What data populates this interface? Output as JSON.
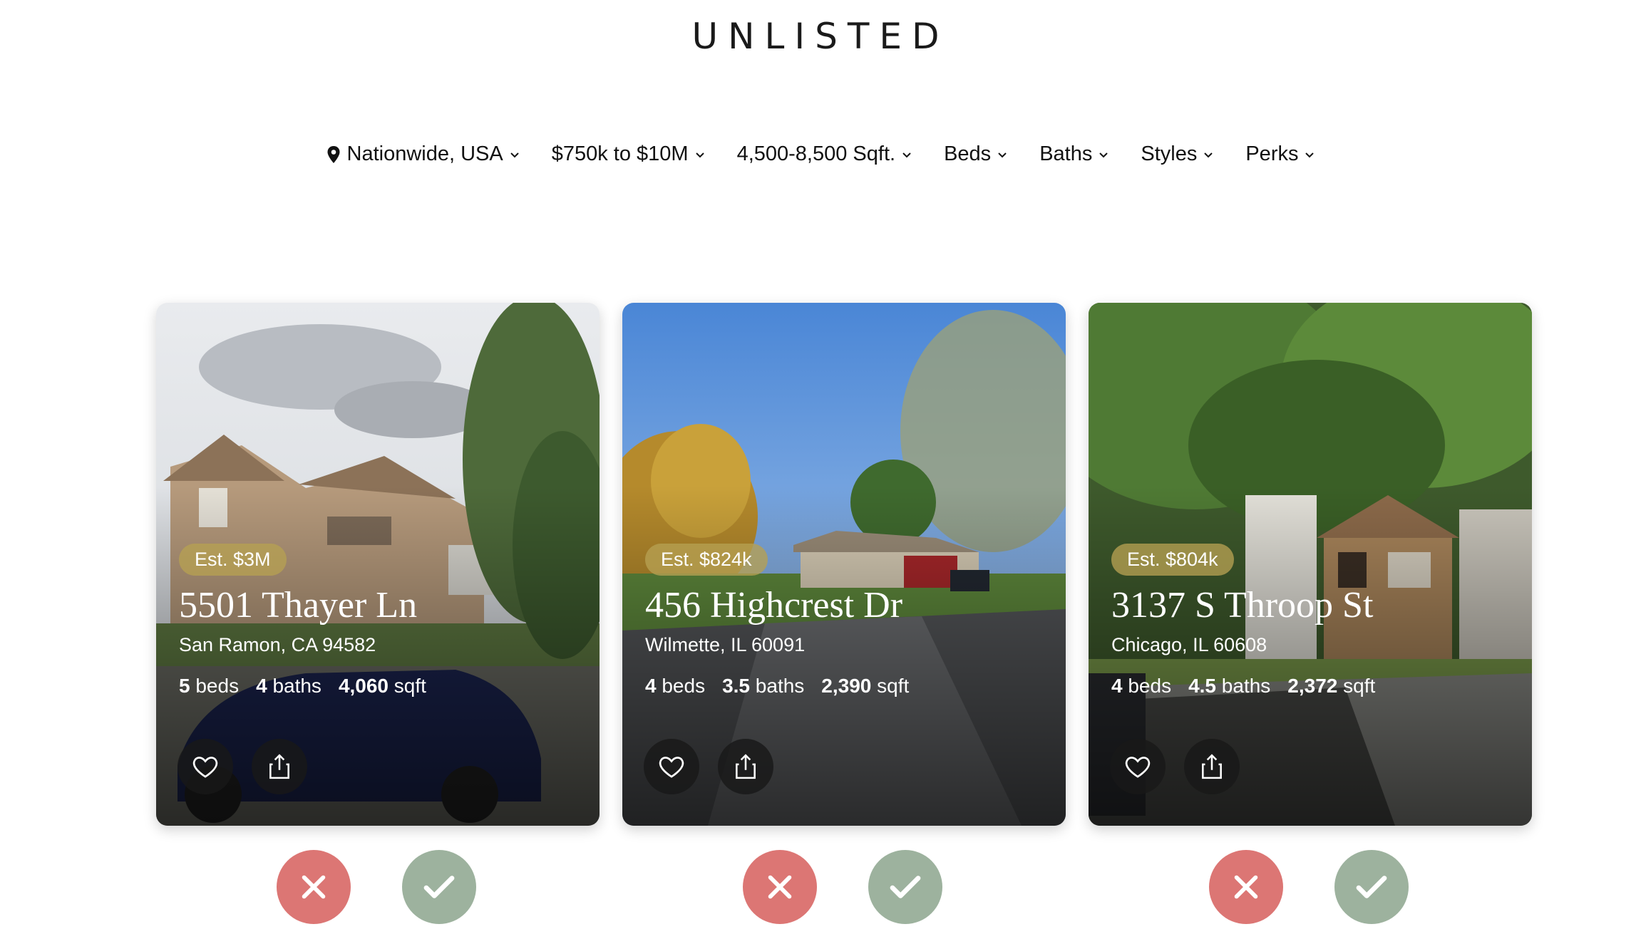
{
  "brand": {
    "logo": "UNLISTED"
  },
  "filters": [
    {
      "label": "Nationwide, USA",
      "icon": "location-pin-icon"
    },
    {
      "label": "$750k to $10M"
    },
    {
      "label": "4,500-8,500 Sqft."
    },
    {
      "label": "Beds"
    },
    {
      "label": "Baths"
    },
    {
      "label": "Styles"
    },
    {
      "label": "Perks"
    }
  ],
  "listings": [
    {
      "estimate": "Est. $3M",
      "address": "5501 Thayer Ln",
      "city": "San Ramon, CA 94582",
      "beds": "5",
      "beds_label": "beds",
      "baths": "4",
      "baths_label": "baths",
      "sqft": "4,060",
      "sqft_label": "sqft"
    },
    {
      "estimate": "Est. $824k",
      "address": "456 Highcrest Dr",
      "city": "Wilmette, IL 60091",
      "beds": "4",
      "beds_label": "beds",
      "baths": "3.5",
      "baths_label": "baths",
      "sqft": "2,390",
      "sqft_label": "sqft"
    },
    {
      "estimate": "Est. $804k",
      "address": "3137 S Throop St",
      "city": "Chicago, IL 60608",
      "beds": "4",
      "beds_label": "beds",
      "baths": "4.5",
      "baths_label": "baths",
      "sqft": "2,372",
      "sqft_label": "sqft"
    }
  ],
  "colors": {
    "reject": "#dc7674",
    "accept": "#9db29e",
    "estimate_badge": "#b6a052"
  }
}
